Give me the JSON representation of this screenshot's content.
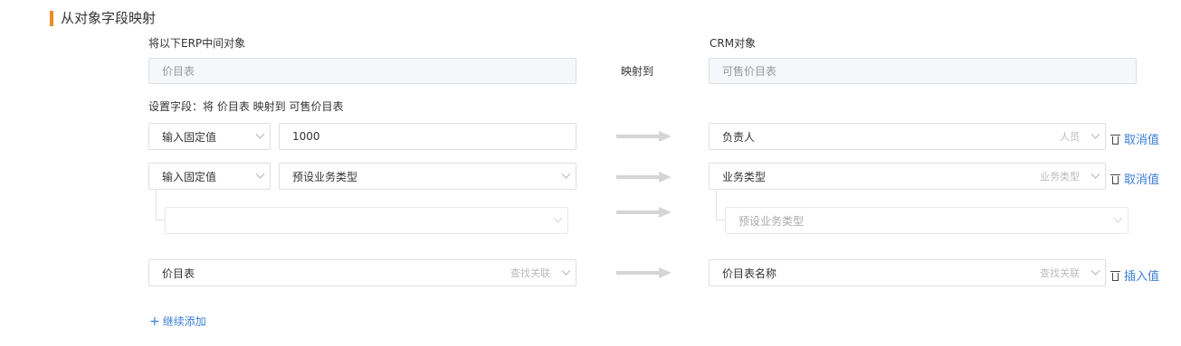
{
  "section": {
    "title": "从对象字段映射"
  },
  "source": {
    "label": "将以下ERP中间对象",
    "value": "价目表"
  },
  "mapping_label": "映射到",
  "target": {
    "label": "CRM对象",
    "value": "可售价目表"
  },
  "field_caption": "设置字段：将 价目表 映射到 可售价目表",
  "rows": [
    {
      "mode": "输入固定值",
      "value": "1000",
      "target_field": "负责人",
      "target_type": "人员",
      "action": "取消值"
    },
    {
      "mode": "输入固定值",
      "value": "预设业务类型",
      "target_field": "业务类型",
      "target_type": "业务类型",
      "action": "取消值",
      "sub_source_value": "",
      "sub_target_value": "预设业务类型"
    },
    {
      "value": "价目表",
      "value_hint": "查找关联",
      "target_field": "价目表名称",
      "target_type": "查找关联",
      "action": "插入值"
    }
  ],
  "add_more": "继续添加",
  "colors": {
    "accent": "#f08a24",
    "link": "#3a7fd8",
    "arrow": "#d5d5d5"
  }
}
